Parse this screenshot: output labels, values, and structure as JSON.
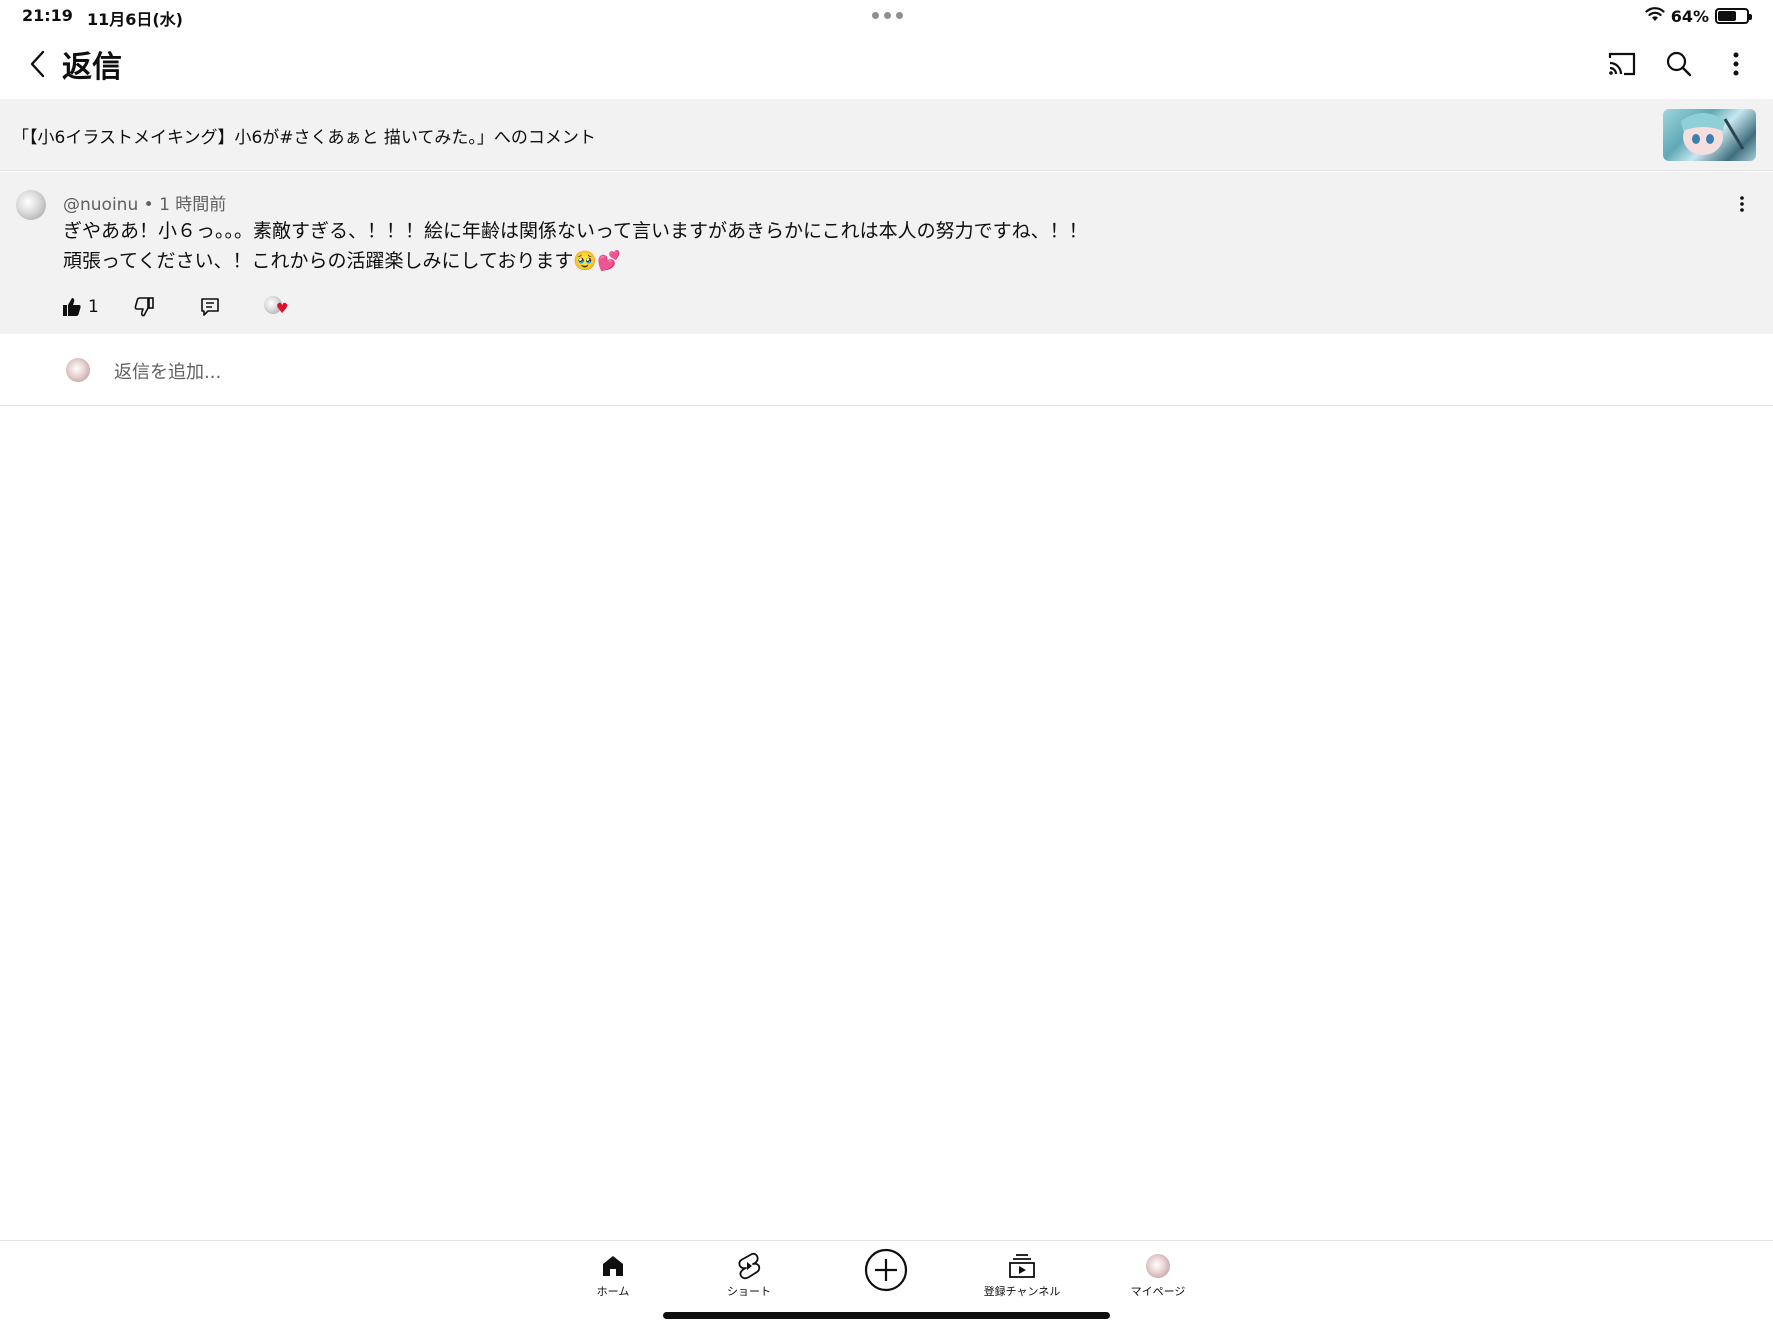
{
  "status_bar": {
    "time": "21:19",
    "date": "11月6日(水)",
    "battery_percent": "64%",
    "battery_level": 0.64
  },
  "header": {
    "title": "返信",
    "icons": [
      "back-icon",
      "cast-icon",
      "search-icon",
      "more-vert-icon"
    ]
  },
  "video": {
    "context_text": "「【小6イラストメイキング】小6が#さくあぁと 描いてみた。」へのコメント"
  },
  "comment": {
    "author": "@nuoinu",
    "separator": "•",
    "time": "1 時間前",
    "line1": "ぎやああ！小６っ。。。素敵すぎる、！！！絵に年齢は関係ないって言いますがあきらかにこれは本人の努力ですね、！！",
    "line2": "頑張ってください、！これからの活躍楽しみにしております",
    "emoji": "🥹💕",
    "like_count": "1"
  },
  "reply": {
    "placeholder": "返信を追加..."
  },
  "bottom_nav": {
    "items": [
      {
        "label": "ホーム",
        "icon": "home-icon"
      },
      {
        "label": "ショート",
        "icon": "shorts-icon"
      },
      {
        "label": "",
        "icon": "create-icon"
      },
      {
        "label": "登録チャンネル",
        "icon": "subscriptions-icon"
      },
      {
        "label": "マイページ",
        "icon": "avatar-icon"
      }
    ]
  }
}
